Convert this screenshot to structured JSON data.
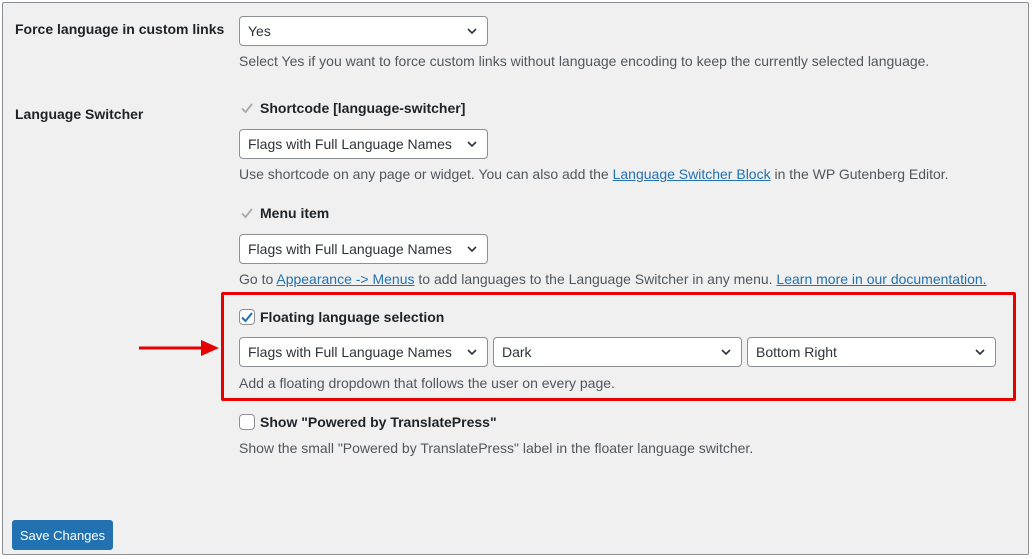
{
  "force_language": {
    "label": "Force language in custom links",
    "selected": "Yes",
    "description": "Select Yes if you want to force custom links without language encoding to keep the currently selected language."
  },
  "language_switcher": {
    "label": "Language Switcher",
    "shortcode": {
      "label": "Shortcode [language-switcher]",
      "checked": true,
      "selected": "Flags with Full Language Names",
      "desc_before": "Use shortcode on any page or widget. You can also add the ",
      "desc_link": "Language Switcher Block",
      "desc_after": " in the WP Gutenberg Editor."
    },
    "menu_item": {
      "label": "Menu item",
      "checked": true,
      "selected": "Flags with Full Language Names",
      "desc_before": "Go to ",
      "desc_link1": "Appearance -> Menus",
      "desc_middle": " to add languages to the Language Switcher in any menu. ",
      "desc_link2": "Learn more in our documentation."
    },
    "floating": {
      "label": "Floating language selection",
      "checked": true,
      "style_selected": "Flags with Full Language Names",
      "theme_selected": "Dark",
      "position_selected": "Bottom Right",
      "description": "Add a floating dropdown that follows the user on every page."
    },
    "powered_by": {
      "label": "Show \"Powered by TranslatePress\"",
      "checked": false,
      "description": "Show the small \"Powered by TranslatePress\" label in the floater language switcher."
    }
  },
  "save_button": "Save Changes",
  "colors": {
    "accent": "#2271b1",
    "highlight": "#e60000",
    "background": "#f0f0f1"
  }
}
